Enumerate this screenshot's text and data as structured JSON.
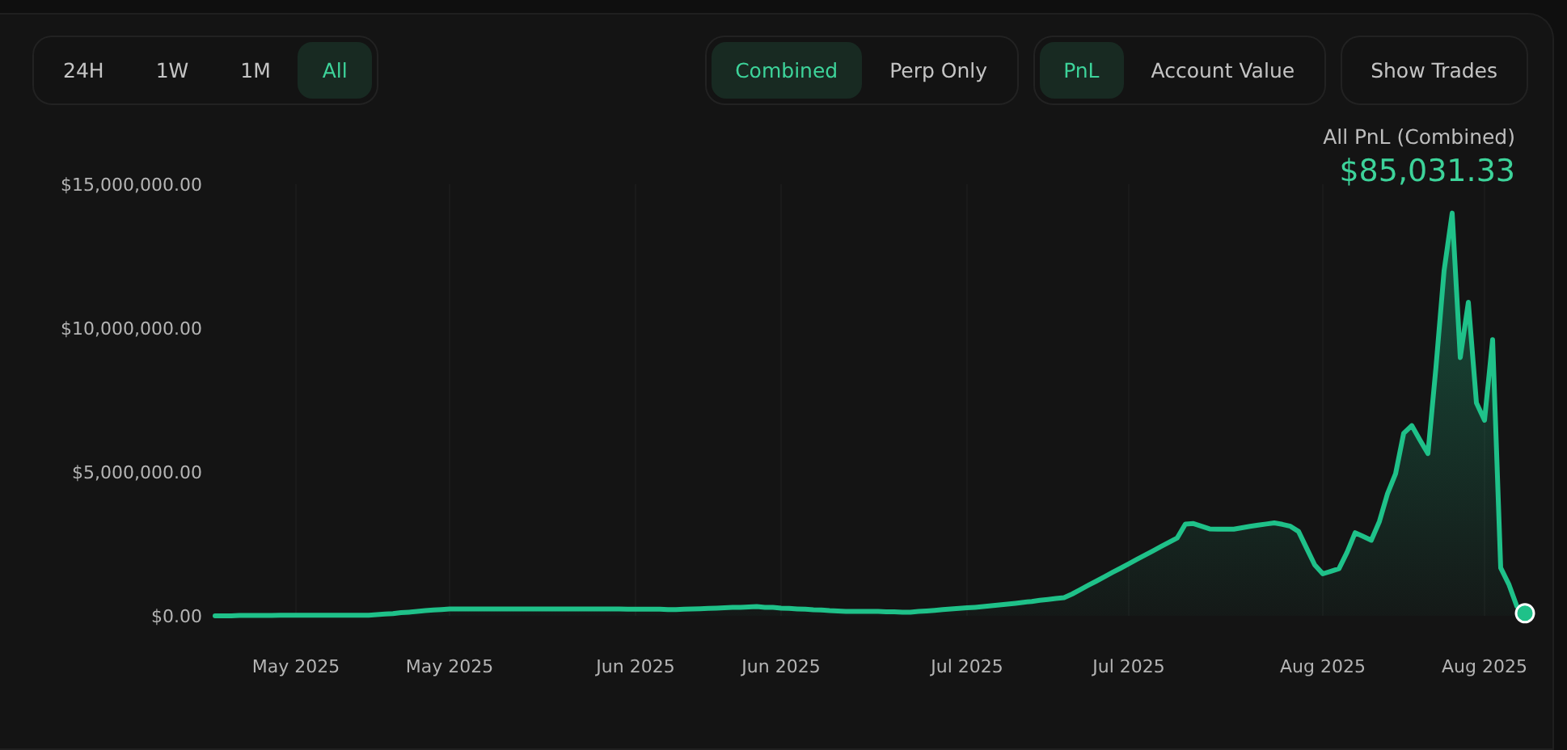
{
  "time_ranges": [
    {
      "label": "24H",
      "selected": false
    },
    {
      "label": "1W",
      "selected": false
    },
    {
      "label": "1M",
      "selected": false
    },
    {
      "label": "All",
      "selected": true
    }
  ],
  "view_modes": [
    {
      "label": "Combined",
      "selected": true
    },
    {
      "label": "Perp Only",
      "selected": false
    }
  ],
  "metrics": [
    {
      "label": "PnL",
      "selected": true
    },
    {
      "label": "Account Value",
      "selected": false
    }
  ],
  "show_trades_button": {
    "label": "Show Trades"
  },
  "summary": {
    "label": "All PnL (Combined)",
    "value": "$85,031.33"
  },
  "chart_data": {
    "type": "area",
    "categories": [
      null,
      null,
      null,
      null,
      null,
      null,
      null,
      null,
      null,
      null,
      "May 2025",
      null,
      null,
      null,
      null,
      null,
      null,
      null,
      null,
      null,
      null,
      null,
      null,
      null,
      null,
      null,
      null,
      null,
      null,
      "May 2025",
      null,
      null,
      null,
      null,
      null,
      null,
      null,
      null,
      null,
      null,
      null,
      null,
      null,
      null,
      null,
      null,
      null,
      null,
      null,
      null,
      null,
      null,
      "Jun 2025",
      null,
      null,
      null,
      null,
      null,
      null,
      null,
      null,
      null,
      null,
      null,
      null,
      null,
      null,
      null,
      null,
      null,
      "Jun 2025",
      null,
      null,
      null,
      null,
      null,
      null,
      null,
      null,
      null,
      null,
      null,
      null,
      null,
      null,
      null,
      null,
      null,
      null,
      null,
      null,
      null,
      null,
      "Jul 2025",
      null,
      null,
      null,
      null,
      null,
      null,
      null,
      null,
      null,
      null,
      null,
      null,
      null,
      null,
      null,
      null,
      null,
      null,
      null,
      "Jul 2025",
      null,
      null,
      null,
      null,
      null,
      null,
      null,
      null,
      null,
      null,
      null,
      null,
      null,
      null,
      null,
      null,
      null,
      null,
      null,
      null,
      null,
      null,
      null,
      "Aug 2025",
      null,
      null,
      null,
      null,
      null,
      null,
      null,
      null,
      null,
      null,
      null,
      null,
      null,
      null,
      null,
      null,
      null,
      null,
      null,
      "Aug 2025",
      null,
      null,
      null,
      null,
      null
    ],
    "series": [
      {
        "color": "#1fc189",
        "values": [
          0,
          0,
          0,
          10000,
          10000,
          10000,
          10000,
          10000,
          20000,
          20000,
          20000,
          20000,
          20000,
          20000,
          20000,
          20000,
          20000,
          20000,
          20000,
          20000,
          40000,
          60000,
          80000,
          110000,
          130000,
          150000,
          180000,
          200000,
          220000,
          240000,
          240000,
          240000,
          240000,
          240000,
          240000,
          240000,
          240000,
          240000,
          240000,
          240000,
          240000,
          240000,
          240000,
          240000,
          240000,
          240000,
          240000,
          240000,
          240000,
          240000,
          240000,
          230000,
          230000,
          230000,
          230000,
          230000,
          220000,
          220000,
          230000,
          240000,
          250000,
          260000,
          270000,
          280000,
          290000,
          300000,
          310000,
          320000,
          300000,
          290000,
          270000,
          260000,
          240000,
          230000,
          210000,
          200000,
          180000,
          170000,
          160000,
          160000,
          160000,
          150000,
          150000,
          140000,
          140000,
          130000,
          130000,
          150000,
          170000,
          190000,
          220000,
          240000,
          260000,
          280000,
          300000,
          320000,
          350000,
          380000,
          410000,
          440000,
          470000,
          500000,
          540000,
          570000,
          600000,
          630000,
          760000,
          910000,
          1060000,
          1210000,
          1360000,
          1510000,
          1660000,
          1810000,
          1960000,
          2110000,
          2260000,
          2410000,
          2560000,
          2710000,
          3190000,
          3210000,
          3110000,
          3020000,
          3010000,
          3010000,
          3010000,
          3060000,
          3110000,
          3150000,
          3190000,
          3230000,
          3180000,
          3110000,
          2930000,
          2350000,
          1770000,
          1460000,
          1550000,
          1640000,
          2210000,
          2890000,
          2760000,
          2630000,
          3280000,
          4250000,
          4940000,
          6340000,
          6610000,
          6120000,
          5640000,
          8660000,
          12000000,
          14000000,
          8980000,
          10900000,
          7400000,
          6800000,
          9600000,
          1670000,
          1100000,
          330000,
          90000
        ]
      }
    ],
    "ylim": [
      0,
      15000000
    ],
    "yticks": [
      {
        "value": 0,
        "label": "$0.00"
      },
      {
        "value": 5000000,
        "label": "$5,000,000.00"
      },
      {
        "value": 10000000,
        "label": "$10,000,000.00"
      },
      {
        "value": 15000000,
        "label": "$15,000,000.00"
      }
    ]
  }
}
